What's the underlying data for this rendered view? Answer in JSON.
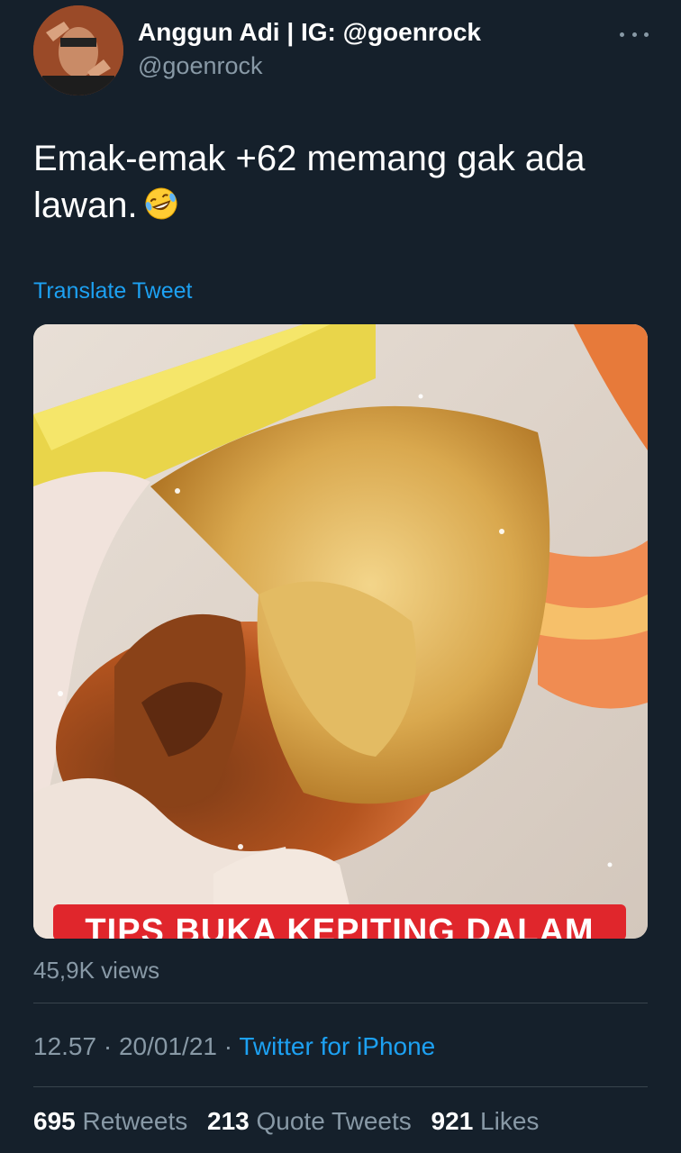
{
  "author": {
    "display_name": "Anggun Adi | IG: @goenrock",
    "handle": "@goenrock"
  },
  "tweet": {
    "text": "Emak-emak +62 memang gak ada lawan.",
    "emoji_icon": "rolling-on-floor-laughing-emoji",
    "translate_label": "Translate Tweet"
  },
  "media": {
    "caption_banner": "TIPS BUKA KEPITING DALAM",
    "views": "45,9K views"
  },
  "meta": {
    "time": "12.57",
    "separator": "·",
    "date": "20/01/21",
    "source": "Twitter for iPhone"
  },
  "stats": {
    "retweets_count": "695",
    "retweets_label": "Retweets",
    "quotes_count": "213",
    "quotes_label": "Quote Tweets",
    "likes_count": "921",
    "likes_label": "Likes"
  },
  "colors": {
    "background": "#15202b",
    "accent": "#1da1f2",
    "secondary_text": "#8899a6",
    "banner_red": "#e0262c"
  }
}
